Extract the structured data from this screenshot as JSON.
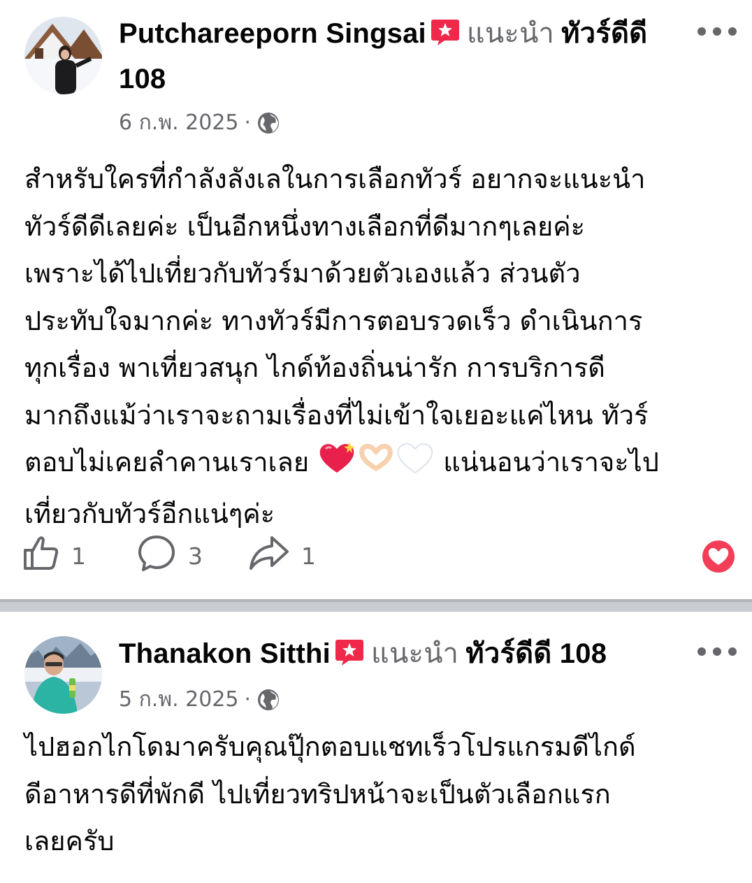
{
  "posts": [
    {
      "author": "Putchareeporn Singsai",
      "recommends": "แนะนำ",
      "page": "ทัวร์ดีดี 108",
      "date": "6 ก.พ. 2025",
      "separator": "·",
      "text_lines": [
        "สำหรับใครที่กำลังลังเลในการเลือกทัวร์ อยากจะแนะนำ",
        "ทัวร์ดีดีเลยค่ะ เป็นอีกหนึ่งทางเลือกที่ดีมากๆเลยค่ะ",
        "เพราะได้ไปเที่ยวกับทัวร์มาด้วยตัวเองแล้ว ส่วนตัว",
        "ประทับใจมากค่ะ ทางทัวร์มีการตอบรวดเร็ว ดำเนินการ",
        "ทุกเรื่อง พาเที่ยวสนุก ไกด์ท้องถิ่นน่ารัก  การบริการดี",
        "มากถึงแม้ว่าเราจะถามเรื่องที่ไม่เข้าใจเยอะแค่ไหน ทัวร์",
        "ตอบไม่เคยลำคานเราเลย",
        "เที่ยวกับทัวร์อีกแน่ๆค่ะ"
      ],
      "text_line7_tail": "แน่นอนว่าเราจะไป",
      "likes": "1",
      "comments": "3",
      "shares": "1"
    },
    {
      "author": "Thanakon Sitthi",
      "recommends": "แนะนำ",
      "page": "ทัวร์ดีดี 108",
      "date": "5 ก.พ. 2025",
      "separator": "·",
      "text_lines": [
        "ไปฮอกไกโดมาครับคุณปุ๊กตอบแชทเร็วโปรแกรมดีไกด์",
        "ดีอาหารดีที่พักดี ไปเที่ยวทริปหน้าจะเป็นตัวเลือกแรก",
        "เลยครับ"
      ]
    }
  ],
  "icons": {
    "badge": "recommend-badge-icon",
    "globe": "public-globe-icon",
    "more": "more-options-icon",
    "like": "thumbs-up-icon",
    "comment": "comment-bubble-icon",
    "share": "share-arrow-icon",
    "reaction": "love-reaction-icon"
  },
  "colors": {
    "secondary_text": "#65676b",
    "badge_red": "#f02849",
    "divider": "#c9ccd1"
  }
}
